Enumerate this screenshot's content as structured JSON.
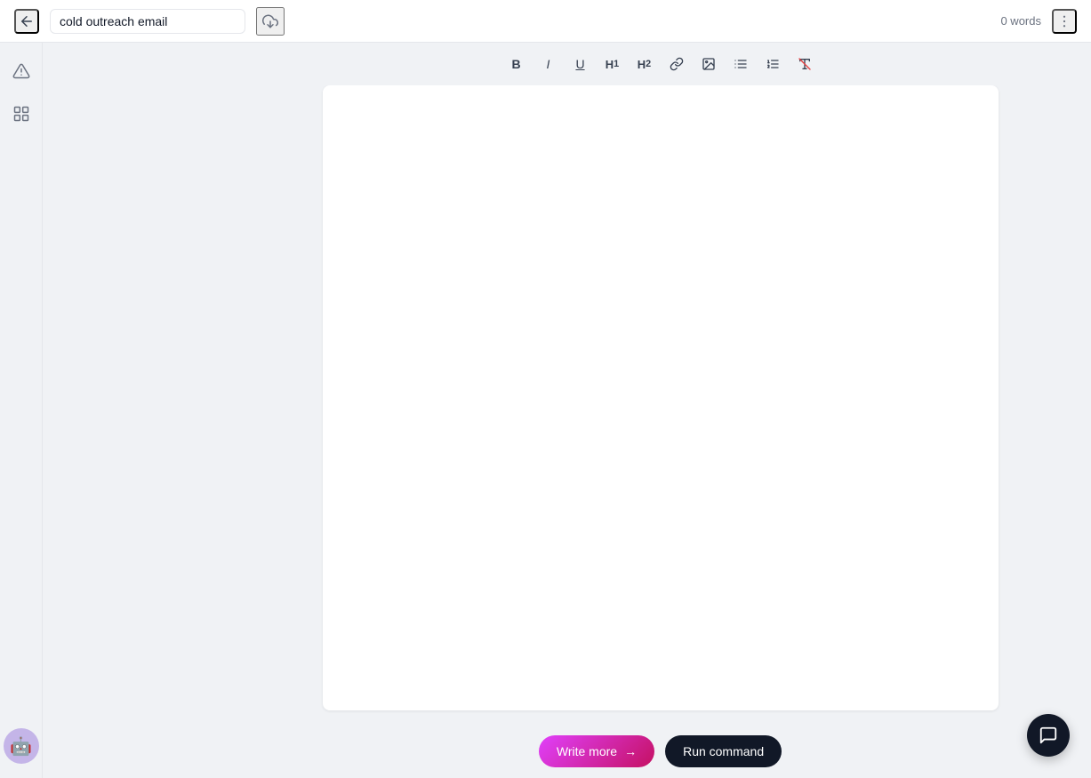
{
  "header": {
    "title": "cold outreach email",
    "word_count": "0 words",
    "back_label": "←",
    "more_label": "⋮"
  },
  "toolbar": {
    "buttons": [
      {
        "id": "bold",
        "label": "B",
        "title": "Bold"
      },
      {
        "id": "italic",
        "label": "I",
        "title": "Italic"
      },
      {
        "id": "underline",
        "label": "U",
        "title": "Underline"
      },
      {
        "id": "h1",
        "label": "H1",
        "title": "Heading 1"
      },
      {
        "id": "h2",
        "label": "H2",
        "title": "Heading 2"
      },
      {
        "id": "link",
        "label": "link",
        "title": "Link"
      },
      {
        "id": "image",
        "label": "img",
        "title": "Image"
      },
      {
        "id": "bullet-list",
        "label": "ul",
        "title": "Bullet List"
      },
      {
        "id": "numbered-list",
        "label": "ol",
        "title": "Numbered List"
      },
      {
        "id": "clear-format",
        "label": "Tx",
        "title": "Clear Formatting"
      }
    ]
  },
  "editor": {
    "placeholder": ""
  },
  "actions": {
    "write_more": "Write more",
    "write_more_arrow": "→",
    "run_command": "Run command"
  },
  "sidebar": {
    "alert_icon": "alert",
    "apps_icon": "apps"
  },
  "chat_fab": {
    "icon": "💬"
  }
}
